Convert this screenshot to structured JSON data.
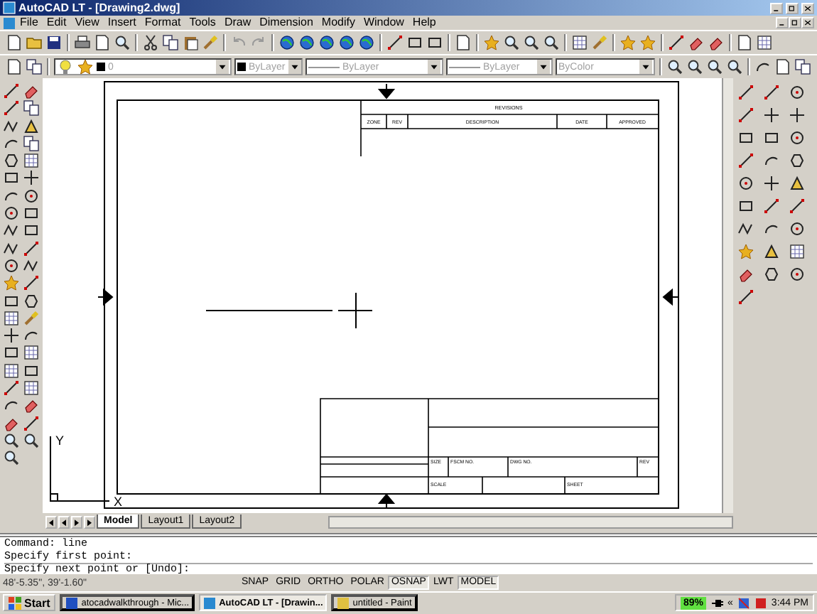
{
  "window": {
    "title": "AutoCAD LT - [Drawing2.dwg]"
  },
  "menu": [
    "File",
    "Edit",
    "View",
    "Insert",
    "Format",
    "Tools",
    "Draw",
    "Dimension",
    "Modify",
    "Window",
    "Help"
  ],
  "properties_toolbar": {
    "layer": "0",
    "color_control": "ByLayer",
    "linetype": "ByLayer",
    "lineweight": "ByLayer",
    "plot_style": "ByColor"
  },
  "title_block": {
    "revisions_heading": "REVISIONS",
    "revision_columns": [
      "ZONE",
      "REV",
      "DESCRIPTION",
      "DATE",
      "APPROVED"
    ],
    "upper_labels": [
      "SIZE",
      "FSCM NO.",
      "DWG NO.",
      "REV"
    ],
    "lower_labels": [
      "SCALE",
      "SHEET"
    ]
  },
  "ucs": {
    "x_label": "X",
    "y_label": "Y"
  },
  "layout_tabs": [
    {
      "label": "Model",
      "selected": true
    },
    {
      "label": "Layout1",
      "selected": false
    },
    {
      "label": "Layout2",
      "selected": false
    }
  ],
  "command_lines": [
    "Command: line",
    "Specify first point:",
    "Specify next point or [Undo]:"
  ],
  "status_bar": {
    "coordinates": "48'-5.35\", 39'-1.60\"",
    "toggles": [
      {
        "label": "SNAP",
        "on": false
      },
      {
        "label": "GRID",
        "on": false
      },
      {
        "label": "ORTHO",
        "on": false
      },
      {
        "label": "POLAR",
        "on": false
      },
      {
        "label": "OSNAP",
        "on": true
      },
      {
        "label": "LWT",
        "on": false
      },
      {
        "label": "MODEL",
        "on": true
      }
    ]
  },
  "taskbar": {
    "start": "Start",
    "tasks": [
      {
        "label": "atocadwalkthrough - Mic...",
        "selected": false
      },
      {
        "label": "AutoCAD LT - [Drawin...",
        "selected": true
      },
      {
        "label": "untitled - Paint",
        "selected": false
      }
    ],
    "tray": {
      "battery": "89%",
      "expand": "«",
      "clock": "3:44 PM"
    }
  }
}
